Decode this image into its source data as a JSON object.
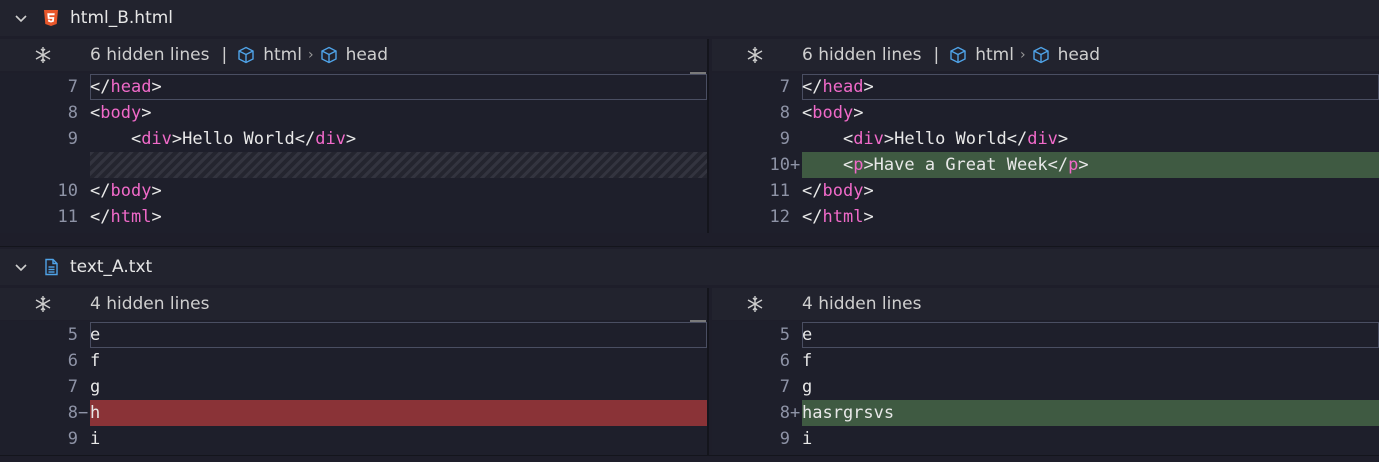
{
  "files": [
    {
      "name": "html_B.html",
      "icon": "html5-icon",
      "left": {
        "hidden": "6 hidden lines",
        "crumbs": [
          "html",
          "head"
        ],
        "lines": [
          {
            "num": "7",
            "marker": "",
            "type": "normal",
            "parts": [
              [
                "</",
                "p"
              ],
              [
                "head",
                "t"
              ],
              [
                ">",
                "p"
              ]
            ]
          },
          {
            "num": "8",
            "marker": "",
            "type": "normal",
            "parts": [
              [
                "<",
                "p"
              ],
              [
                "body",
                "t"
              ],
              [
                ">",
                "p"
              ]
            ]
          },
          {
            "num": "9",
            "marker": "",
            "type": "normal",
            "parts": [
              [
                "    <",
                "p"
              ],
              [
                "div",
                "t"
              ],
              [
                ">Hello World</",
                "p"
              ],
              [
                "div",
                "t"
              ],
              [
                ">",
                "p"
              ]
            ]
          },
          {
            "num": "",
            "marker": "",
            "type": "filler",
            "parts": []
          },
          {
            "num": "10",
            "marker": "",
            "type": "normal",
            "parts": [
              [
                "</",
                "p"
              ],
              [
                "body",
                "t"
              ],
              [
                ">",
                "p"
              ]
            ]
          },
          {
            "num": "11",
            "marker": "",
            "type": "normal",
            "parts": [
              [
                "</",
                "p"
              ],
              [
                "html",
                "t"
              ],
              [
                ">",
                "p"
              ]
            ]
          }
        ]
      },
      "right": {
        "hidden": "6 hidden lines",
        "crumbs": [
          "html",
          "head"
        ],
        "lines": [
          {
            "num": "7",
            "marker": "",
            "type": "normal",
            "parts": [
              [
                "</",
                "p"
              ],
              [
                "head",
                "t"
              ],
              [
                ">",
                "p"
              ]
            ]
          },
          {
            "num": "8",
            "marker": "",
            "type": "normal",
            "parts": [
              [
                "<",
                "p"
              ],
              [
                "body",
                "t"
              ],
              [
                ">",
                "p"
              ]
            ]
          },
          {
            "num": "9",
            "marker": "",
            "type": "normal",
            "parts": [
              [
                "    <",
                "p"
              ],
              [
                "div",
                "t"
              ],
              [
                ">Hello World</",
                "p"
              ],
              [
                "div",
                "t"
              ],
              [
                ">",
                "p"
              ]
            ]
          },
          {
            "num": "10",
            "marker": "+",
            "type": "added",
            "parts": [
              [
                "    <",
                "p"
              ],
              [
                "p",
                "t"
              ],
              [
                ">Have a Great Week</",
                "p"
              ],
              [
                "p",
                "t"
              ],
              [
                ">",
                "p"
              ]
            ]
          },
          {
            "num": "11",
            "marker": "",
            "type": "normal",
            "parts": [
              [
                "</",
                "p"
              ],
              [
                "body",
                "t"
              ],
              [
                ">",
                "p"
              ]
            ]
          },
          {
            "num": "12",
            "marker": "",
            "type": "normal",
            "parts": [
              [
                "</",
                "p"
              ],
              [
                "html",
                "t"
              ],
              [
                ">",
                "p"
              ]
            ]
          }
        ]
      }
    },
    {
      "name": "text_A.txt",
      "icon": "text-file-icon",
      "left": {
        "hidden": "4 hidden lines",
        "crumbs": [],
        "lines": [
          {
            "num": "5",
            "marker": "",
            "type": "normal",
            "parts": [
              [
                "e",
                "p"
              ]
            ]
          },
          {
            "num": "6",
            "marker": "",
            "type": "normal",
            "parts": [
              [
                "f",
                "p"
              ]
            ]
          },
          {
            "num": "7",
            "marker": "",
            "type": "normal",
            "parts": [
              [
                "g",
                "p"
              ]
            ]
          },
          {
            "num": "8",
            "marker": "−",
            "type": "removed",
            "parts": [
              [
                "h",
                "p"
              ]
            ]
          },
          {
            "num": "9",
            "marker": "",
            "type": "normal",
            "parts": [
              [
                "i",
                "p"
              ]
            ]
          }
        ]
      },
      "right": {
        "hidden": "4 hidden lines",
        "crumbs": [],
        "lines": [
          {
            "num": "5",
            "marker": "",
            "type": "normal",
            "parts": [
              [
                "e",
                "p"
              ]
            ]
          },
          {
            "num": "6",
            "marker": "",
            "type": "normal",
            "parts": [
              [
                "f",
                "p"
              ]
            ]
          },
          {
            "num": "7",
            "marker": "",
            "type": "normal",
            "parts": [
              [
                "g",
                "p"
              ]
            ]
          },
          {
            "num": "8",
            "marker": "+",
            "type": "added",
            "parts": [
              [
                "hasrgrsvs",
                "p"
              ]
            ]
          },
          {
            "num": "9",
            "marker": "",
            "type": "normal",
            "parts": [
              [
                "i",
                "p"
              ]
            ]
          }
        ]
      }
    }
  ],
  "colors": {
    "added": "#3f5a42",
    "removed": "#8a3337",
    "tag": "#f06ac9",
    "html_icon": "#e8572b",
    "text_icon": "#4fa3e8",
    "cube_icon": "#4fa3e8"
  }
}
